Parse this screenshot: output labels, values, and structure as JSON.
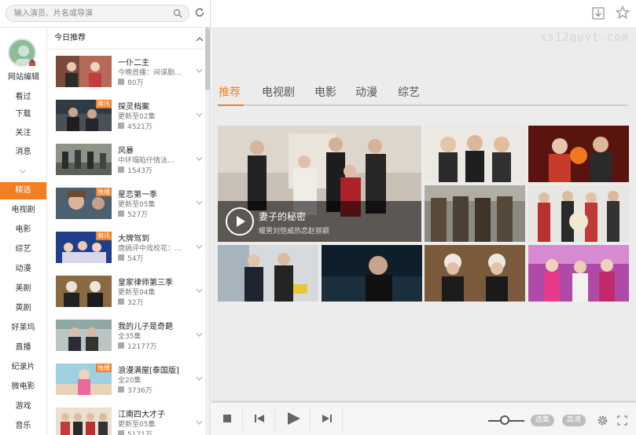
{
  "search": {
    "placeholder": "输入演员、片名或导演"
  },
  "user": {
    "name": "网站编辑"
  },
  "nav": {
    "items": [
      "看过",
      "下载",
      "关注",
      "消息"
    ],
    "categories": [
      "精选",
      "电视剧",
      "电影",
      "综艺",
      "动漫",
      "美剧",
      "英剧",
      "好莱坞",
      "直播",
      "纪录片",
      "微电影",
      "游戏",
      "音乐"
    ],
    "active": "精选"
  },
  "list": {
    "header": "今日推荐",
    "items": [
      {
        "title": "一仆二主",
        "sub": "今晚首播：间谍剧…",
        "count": "80万",
        "badge": ""
      },
      {
        "title": "探灵档案",
        "sub": "更新至02集",
        "count": "4521万",
        "badge": "腾讯"
      },
      {
        "title": "风暴",
        "sub": "中环塌陷仔情法…",
        "count": "1543万",
        "badge": ""
      },
      {
        "title": "星恋第一季",
        "sub": "更新至05集",
        "count": "527万",
        "badge": "独播"
      },
      {
        "title": "大牌驾到",
        "sub": "唐嫣评中戏校花：…",
        "count": "54万",
        "badge": "腾讯"
      },
      {
        "title": "皇家律师第三季",
        "sub": "更新至04集",
        "count": "32万",
        "badge": ""
      },
      {
        "title": "我的儿子是奇葩",
        "sub": "全35集",
        "count": "12177万",
        "badge": ""
      },
      {
        "title": "浪漫满屋[泰国版]",
        "sub": "全20集",
        "count": "3736万",
        "badge": "独播"
      },
      {
        "title": "江南四大才子",
        "sub": "更新至05集",
        "count": "5171万",
        "badge": ""
      }
    ]
  },
  "watermark": "xs12quvt.com",
  "tabs": [
    "推荐",
    "电视剧",
    "电影",
    "动漫",
    "综艺"
  ],
  "active_tab": "推荐",
  "featured": {
    "title": "妻子的秘密",
    "subtitle": "暖男刘恺威热恋赵丽颖"
  },
  "player": {
    "select_label": "选集",
    "quality_label": "高清"
  },
  "colors": {
    "accent": "#f47f20",
    "panel": "#ececec"
  },
  "icons": [
    "search-icon",
    "refresh-icon",
    "download-icon",
    "star-icon",
    "stop-icon",
    "prev-icon",
    "play-icon",
    "next-icon",
    "settings-icon",
    "fullscreen-icon"
  ]
}
